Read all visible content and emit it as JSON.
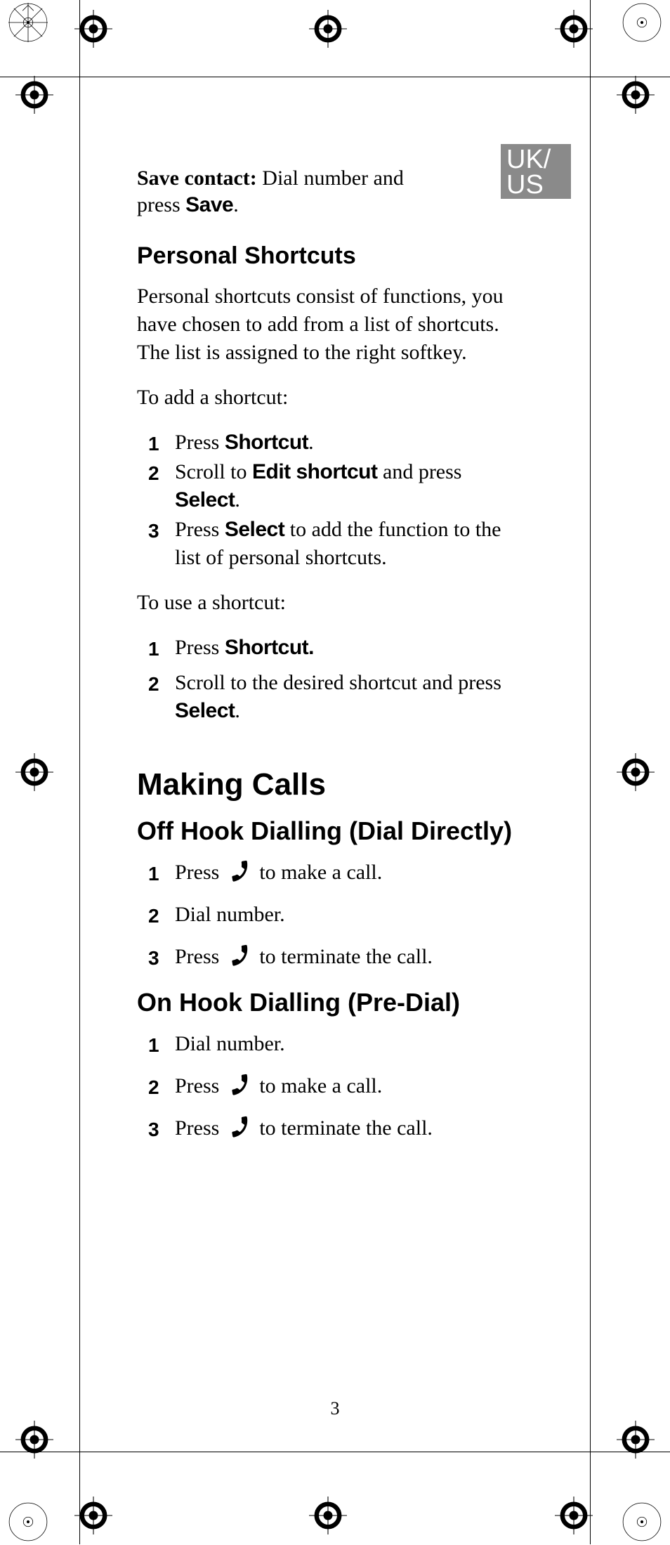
{
  "lang_tab": {
    "line1": "UK/",
    "line2": "US"
  },
  "save_contact": {
    "label": "Save contact:",
    "text": " Dial number and press ",
    "key": "Save",
    "period": "."
  },
  "personal_shortcuts": {
    "heading": "Personal Shortcuts",
    "intro": "Personal shortcuts consist of functions, you have chosen to add from a list of shortcuts. The list is assigned to the right softkey.",
    "to_add": "To add a shortcut:",
    "add_steps": [
      {
        "n": "1",
        "pre": "Press ",
        "k1": "Shortcut",
        "post": "."
      },
      {
        "n": "2",
        "pre": "Scroll to ",
        "k1": "Edit shortcut",
        "mid": " and press ",
        "k2": "Select",
        "post": "."
      },
      {
        "n": "3",
        "pre": "Press ",
        "k1": "Select",
        "post": " to add the function to the list of personal shortcuts."
      }
    ],
    "to_use": "To use a shortcut:",
    "use_steps": [
      {
        "n": "1",
        "pre": "Press ",
        "k1": "Shortcut.",
        "post": ""
      },
      {
        "n": "2",
        "pre": "Scroll to the desired shortcut and press ",
        "k1": "Select",
        "post": "."
      }
    ]
  },
  "making_calls": {
    "heading": "Making Calls",
    "off_hook": {
      "heading": "Off Hook Dialling (Dial Directly)",
      "steps": [
        {
          "n": "1",
          "pre": "Press ",
          "icon": true,
          "post": " to make a call."
        },
        {
          "n": "2",
          "pre": "Dial number.",
          "icon": false,
          "post": ""
        },
        {
          "n": "3",
          "pre": "Press ",
          "icon": true,
          "post": " to terminate the call."
        }
      ]
    },
    "on_hook": {
      "heading": "On Hook Dialling (Pre-Dial)",
      "steps": [
        {
          "n": "1",
          "pre": "Dial number.",
          "icon": false,
          "post": ""
        },
        {
          "n": "2",
          "pre": "Press ",
          "icon": true,
          "post": " to make a call."
        },
        {
          "n": "3",
          "pre": "Press ",
          "icon": true,
          "post": " to terminate the call."
        }
      ]
    }
  },
  "page_number": "3"
}
